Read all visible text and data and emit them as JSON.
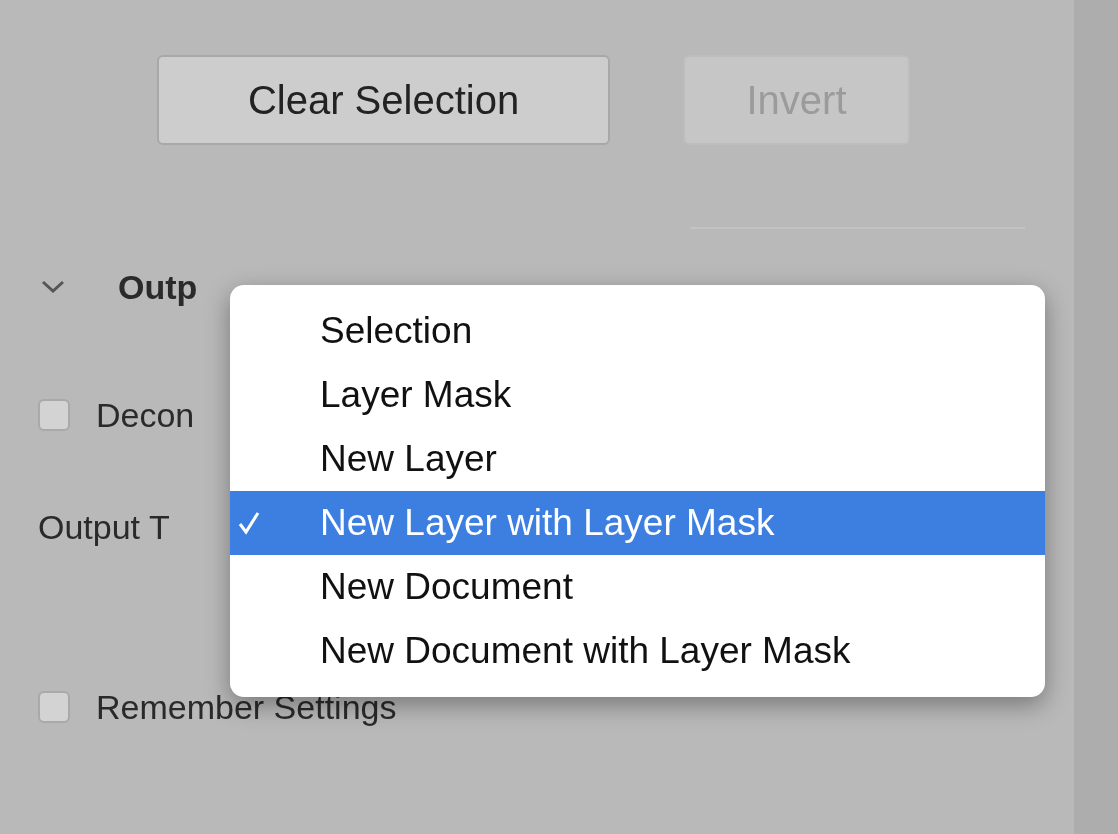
{
  "buttons": [
    {
      "label": "Clear Selection",
      "disabled": false
    },
    {
      "label": "Invert",
      "disabled": true
    }
  ],
  "section": {
    "title": "Outp",
    "expanded": true
  },
  "decontaminate": {
    "label": "Decon",
    "checked": false
  },
  "output_to": {
    "label": "Output T"
  },
  "remember": {
    "label": "Remember Settings",
    "checked": false
  },
  "menu": {
    "items": [
      {
        "label": "Selection",
        "selected": false,
        "checked": false
      },
      {
        "label": "Layer Mask",
        "selected": false,
        "checked": false
      },
      {
        "label": "New Layer",
        "selected": false,
        "checked": false
      },
      {
        "label": "New Layer with Layer Mask",
        "selected": true,
        "checked": true
      },
      {
        "label": "New Document",
        "selected": false,
        "checked": false
      },
      {
        "label": "New Document with Layer Mask",
        "selected": false,
        "checked": false
      }
    ]
  }
}
